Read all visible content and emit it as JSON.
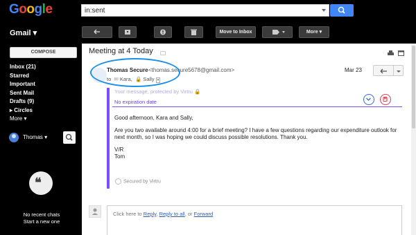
{
  "app": {
    "logo": "Google",
    "logo_colors": [
      "#4285f4",
      "#ea4335",
      "#fbbc05",
      "#4285f4",
      "#34a853",
      "#ea4335"
    ]
  },
  "search": {
    "value": "in:sent"
  },
  "sidebar": {
    "gmail_label": "Gmail ▾",
    "compose_label": "COMPOSE",
    "items": [
      {
        "label": "Inbox (21)",
        "bold": true
      },
      {
        "label": "Starred",
        "bold": true
      },
      {
        "label": "Important",
        "bold": true
      },
      {
        "label": "Sent Mail",
        "bold": true
      },
      {
        "label": "Drafts (9)",
        "bold": true
      },
      {
        "label": "Circles",
        "bold": true
      },
      {
        "label": "More ▾",
        "bold": false
      }
    ],
    "user_name": "Thomas ▾",
    "no_chats": "No recent chats",
    "start_new": "Start a new one"
  },
  "toolbar": {
    "move_to_inbox": "Move to Inbox",
    "more": "More ▾"
  },
  "email": {
    "subject": "Meeting at 4 Today",
    "sender_name": "Thomas Secure",
    "sender_email": "<thomas.secure5678@gmail.com>",
    "to_prefix": "to",
    "recipient_1": "Kara,",
    "recipient_2": "Sally",
    "date": "Mar 23",
    "virtru_header": "Your message, protected by Virtru",
    "virtru_expiration": "No expiration date",
    "greeting": "Good afternoon, Kara and Sally,",
    "body_line_1": "Are you two available around 4:00 for a brief meeting? I have a few questions regarding our expenditure outlook for",
    "body_line_2": "next month, so I was hoping we could discuss possible resolutions. Thank you.",
    "sign_1": "V/R",
    "sign_2": "Tom",
    "secured_by": "Secured by Virtru"
  },
  "reply": {
    "prefix": "Click here to",
    "reply": "Reply",
    "sep1": ",",
    "reply_all": "Reply to all",
    "sep2": ", or",
    "forward": "Forward"
  }
}
